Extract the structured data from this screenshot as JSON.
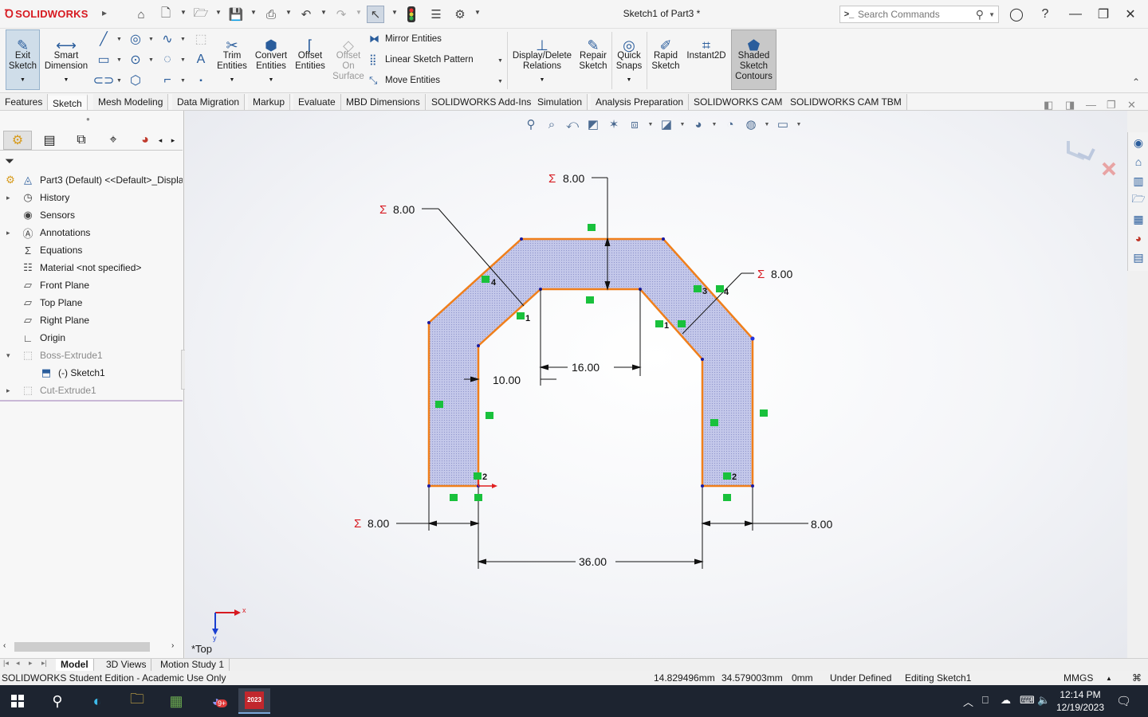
{
  "app": {
    "logo_text": "SOLIDWORKS",
    "doc_title": "Sketch1 of Part3 *",
    "search_placeholder": "Search Commands"
  },
  "ribbon": {
    "exit_sketch": "Exit Sketch",
    "smart_dimension": "Smart Dimension",
    "trim_entities": "Trim Entities",
    "convert_entities": "Convert Entities",
    "offset_entities": "Offset Entities",
    "offset_on_surface": "Offset On Surface",
    "mirror_entities": "Mirror Entities",
    "linear_sketch_pattern": "Linear Sketch Pattern",
    "move_entities": "Move Entities",
    "display_delete_relations": "Display/Delete Relations",
    "repair_sketch": "Repair Sketch",
    "quick_snaps": "Quick Snaps",
    "rapid_sketch": "Rapid Sketch",
    "instant2d": "Instant2D",
    "shaded_sketch_contours": "Shaded Sketch Contours"
  },
  "tabs": [
    "Features",
    "Sketch",
    "Mesh Modeling",
    "Data Migration",
    "Markup",
    "Evaluate",
    "MBD Dimensions",
    "SOLIDWORKS Add-Ins",
    "Simulation",
    "Analysis Preparation",
    "SOLIDWORKS CAM",
    "SOLIDWORKS CAM TBM"
  ],
  "active_tab": "Sketch",
  "tree": {
    "root": "Part3 (Default) <<Default>_Displa",
    "items": [
      "History",
      "Sensors",
      "Annotations",
      "Equations",
      "Material <not specified>",
      "Front Plane",
      "Top Plane",
      "Right Plane",
      "Origin",
      "Boss-Extrude1",
      "(-) Sketch1",
      "Cut-Extrude1"
    ]
  },
  "sketch": {
    "dims": {
      "top_left_diag": "8.00",
      "top_vertical": "8.00",
      "right_diag": "8.00",
      "inner_width": "16.00",
      "inner_height": "10.00",
      "left_bottom": "8.00",
      "right_bottom": "8.00",
      "overall": "36.00"
    },
    "sigma": "Σ",
    "relation_labels": [
      "4",
      "1",
      "3",
      "4",
      "1",
      "2",
      "2"
    ],
    "outline_color": "#f07f1b",
    "fill_color": "#b9bee6"
  },
  "view": {
    "orientation_label": "*Top",
    "triad_x": "x",
    "triad_y": "y"
  },
  "bottom_tabs": [
    "Model",
    "3D Views",
    "Motion Study 1"
  ],
  "active_bottom_tab": "Model",
  "status": {
    "edition": "SOLIDWORKS Student Edition - Academic Use Only",
    "x_coord": "14.829496mm",
    "y_coord": "34.579003mm",
    "z_coord": "0mm",
    "definition": "Under Defined",
    "editing": "Editing Sketch1",
    "units": "MMGS"
  },
  "taskbar": {
    "time": "12:14 PM",
    "date": "12/19/2023",
    "discord_badge": "9+",
    "sw_badge": "2023"
  }
}
